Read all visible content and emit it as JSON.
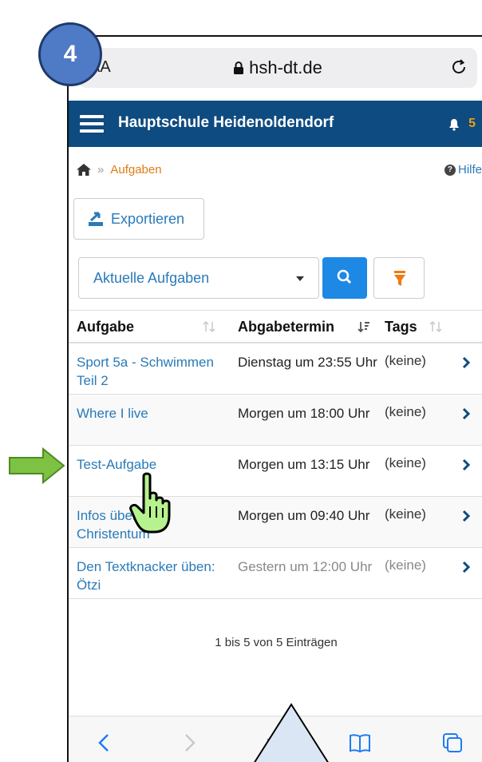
{
  "step_badge": "4",
  "browser": {
    "aa_label": "AA",
    "url": "hsh-dt.de"
  },
  "app": {
    "title": "Hauptschule Heidenoldendorf",
    "notification_count": "5"
  },
  "breadcrumb": {
    "separator": "»",
    "current": "Aufgaben",
    "help": "Hilfe"
  },
  "actions": {
    "export_label": "Exportieren"
  },
  "filter": {
    "selected": "Aktuelle Aufgaben"
  },
  "table": {
    "headers": {
      "task": "Aufgabe",
      "due": "Abgabetermin",
      "tags": "Tags"
    },
    "rows": [
      {
        "task": "Sport 5a - Schwimmen Teil 2",
        "due": "Dienstag um 23:55 Uhr",
        "tags": "(keine)"
      },
      {
        "task": "Where I live",
        "due": "Morgen um 18:00 Uhr",
        "tags": "(keine)"
      },
      {
        "task": "Test-Aufgabe",
        "due": "Morgen um 13:15 Uhr",
        "tags": "(keine)"
      },
      {
        "task": "Infos über das Christentum",
        "due": "Morgen um 09:40 Uhr",
        "tags": "(keine)"
      },
      {
        "task": "Den Textknacker üben: Ötzi",
        "due": "Gestern um 12:00 Uhr",
        "tags": "(keine)"
      }
    ],
    "count_text": "1 bis 5 von 5 Einträgen"
  },
  "icons": {
    "menu": "hamburger-icon",
    "bell": "bell-icon",
    "home": "home-icon",
    "search": "search-icon",
    "filter": "funnel-icon",
    "export": "export-icon",
    "chevron": "chevron-right-icon"
  },
  "colors": {
    "header": "#0e4b80",
    "link": "#2a7ab8",
    "accent": "#e07b12",
    "search_button": "#1e88e5",
    "step_badge": "#4f7ac6",
    "arrow": "#7dc242"
  }
}
